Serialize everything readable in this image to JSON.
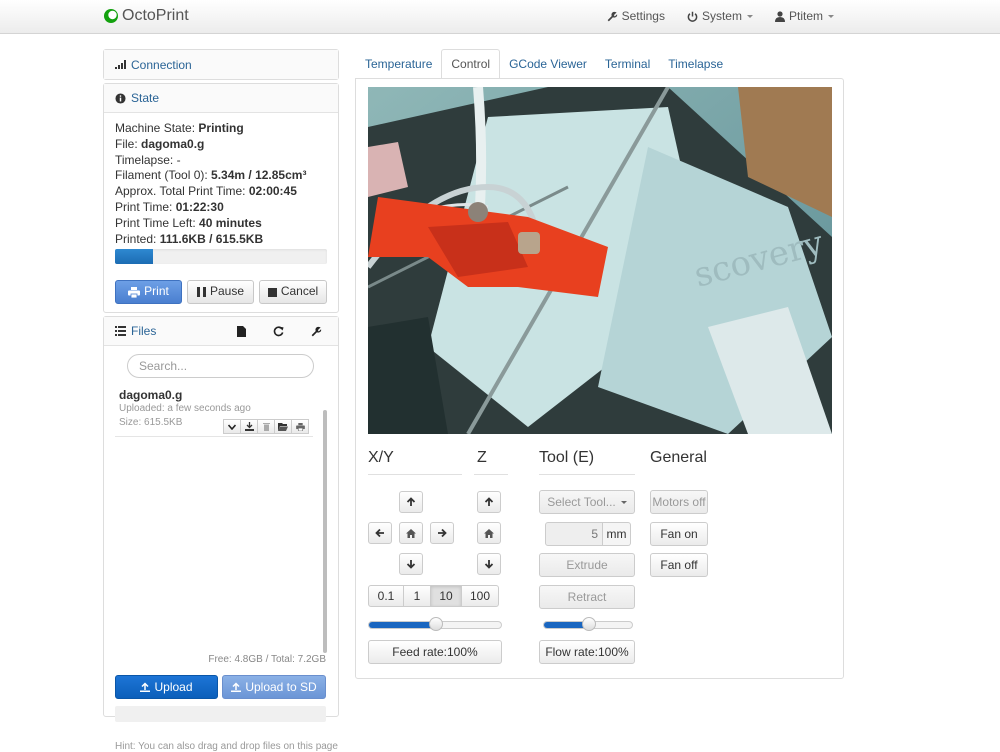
{
  "navbar": {
    "brand": "OctoPrint",
    "settings": "Settings",
    "system": "System",
    "user": "Ptitem"
  },
  "sidebar": {
    "connection": {
      "title": "Connection"
    },
    "state": {
      "title": "State",
      "machine_state_label": "Machine State:",
      "machine_state": "Printing",
      "file_label": "File:",
      "file": "dagoma0.g",
      "timelapse_label": "Timelapse:",
      "timelapse": "-",
      "filament_label": "Filament (Tool 0):",
      "filament": "5.34m / 12.85cm³",
      "approx_label": "Approx. Total Print Time:",
      "approx": "02:00:45",
      "print_time_label": "Print Time:",
      "print_time": "01:22:30",
      "time_left_label": "Print Time Left:",
      "time_left": "40 minutes",
      "printed_label": "Printed:",
      "printed": "111.6KB / 615.5KB",
      "progress_percent": 18,
      "buttons": {
        "print": "Print",
        "pause": "Pause",
        "cancel": "Cancel"
      }
    },
    "files": {
      "title": "Files",
      "search_placeholder": "Search...",
      "items": [
        {
          "name": "dagoma0.g",
          "uploaded": "Uploaded: a few seconds ago",
          "size": "Size: 615.5KB"
        }
      ],
      "free_total": "Free: 4.8GB / Total: 7.2GB",
      "upload": "Upload",
      "upload_sd": "Upload to SD",
      "hint": "Hint: You can also drag and drop files on this page"
    }
  },
  "tabs": [
    {
      "label": "Temperature"
    },
    {
      "label": "Control",
      "active": true
    },
    {
      "label": "GCode Viewer"
    },
    {
      "label": "Terminal"
    },
    {
      "label": "Timelapse"
    }
  ],
  "control": {
    "xy_title": "X/Y",
    "z_title": "Z",
    "tool_title": "Tool (E)",
    "general_title": "General",
    "steps": [
      "0.1",
      "1",
      "10",
      "100"
    ],
    "active_step": "10",
    "feed_rate": "Feed rate:100%",
    "feed_rate_percent": 100,
    "flow_rate": "Flow rate:100%",
    "flow_rate_percent": 100,
    "select_tool": "Select Tool...",
    "extrude_amount": "5",
    "extrude_unit": "mm",
    "extrude": "Extrude",
    "retract": "Retract",
    "motors_off": "Motors off",
    "fan_on": "Fan on",
    "fan_off": "Fan off"
  },
  "colors": {
    "link": "#2a6496",
    "primary": "#4a7fd0",
    "upload": "#0b5fba",
    "progress": "#1c6cb3",
    "slider": "#1a66c0"
  }
}
